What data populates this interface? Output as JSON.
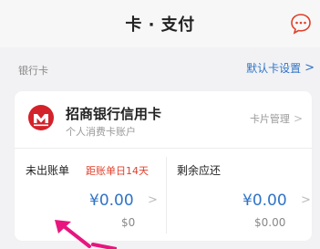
{
  "header": {
    "title": "卡 · 支付"
  },
  "section": {
    "title": "银行卡",
    "default_card_link": "默认卡设置",
    "chevron": ">"
  },
  "card": {
    "bank_name": "招商银行信用卡",
    "account_type": "个人消费卡账户",
    "manage_label": "卡片管理",
    "chevron": ">",
    "unbilled": {
      "label": "未出账单",
      "due_days": "距账单日14天",
      "amount_cny": "¥0.00",
      "amount_usd": "$0"
    },
    "remaining": {
      "label": "剩余应还",
      "amount_cny": "¥0.00",
      "amount_usd": "$0.00"
    }
  },
  "colors": {
    "accent": "#2f73c7",
    "warning": "#e0402c",
    "brand_red": "#d3222a",
    "annotation": "#e8157f"
  },
  "icons": {
    "chat": "chat-bubble-icon",
    "bank": "cmb-logo-icon"
  }
}
